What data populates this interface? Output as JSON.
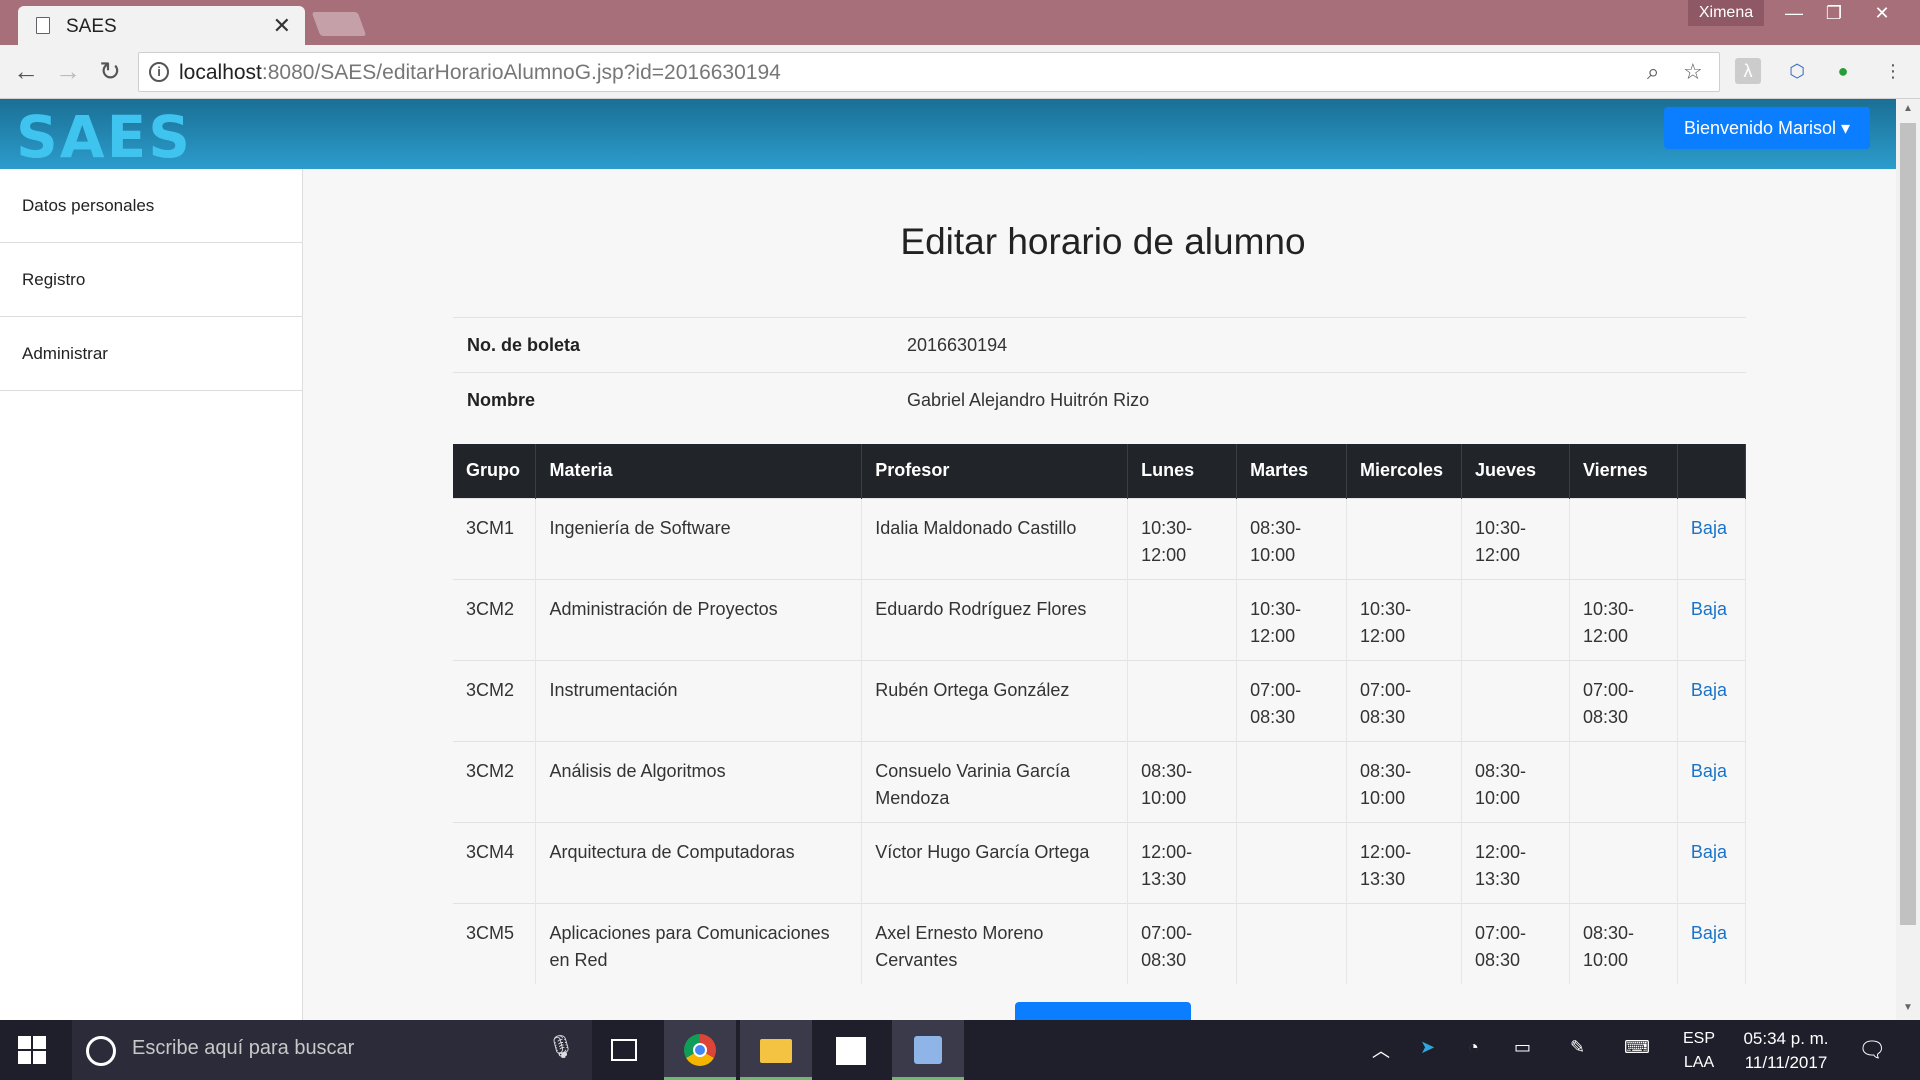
{
  "browser": {
    "tab_title": "SAES",
    "user": "Ximena",
    "url_host": "localhost",
    "url_rest": ":8080/SAES/editarHorarioAlumnoG.jsp?id=2016630194"
  },
  "app": {
    "logo": "SAES",
    "welcome": "Bienvenido Marisol ▾"
  },
  "sidebar": {
    "items": [
      {
        "label": "Datos personales"
      },
      {
        "label": "Registro"
      },
      {
        "label": "Administrar"
      }
    ]
  },
  "main": {
    "title": "Editar horario de alumno",
    "info": [
      {
        "label": "No. de boleta",
        "value": "2016630194"
      },
      {
        "label": "Nombre",
        "value": "Gabriel Alejandro Huitrón Rizo"
      }
    ],
    "columns": [
      "Grupo",
      "Materia",
      "Profesor",
      "Lunes",
      "Martes",
      "Miercoles",
      "Jueves",
      "Viernes",
      ""
    ],
    "rows": [
      {
        "grupo": "3CM1",
        "materia": "Ingeniería de Software",
        "profesor": "Idalia Maldonado Castillo",
        "lunes": "10:30-\n12:00",
        "martes": "08:30-\n10:00",
        "miercoles": "",
        "jueves": "10:30-\n12:00",
        "viernes": "",
        "accion": "Baja"
      },
      {
        "grupo": "3CM2",
        "materia": "Administración de Proyectos",
        "profesor": "Eduardo Rodríguez Flores",
        "lunes": "",
        "martes": "10:30-\n12:00",
        "miercoles": "10:30-\n12:00",
        "jueves": "",
        "viernes": "10:30-\n12:00",
        "accion": "Baja"
      },
      {
        "grupo": "3CM2",
        "materia": "Instrumentación",
        "profesor": "Rubén Ortega González",
        "lunes": "",
        "martes": "07:00-\n08:30",
        "miercoles": "07:00-\n08:30",
        "jueves": "",
        "viernes": "07:00-\n08:30",
        "accion": "Baja"
      },
      {
        "grupo": "3CM2",
        "materia": "Análisis de Algoritmos",
        "profesor": "Consuelo Varinia García Mendoza",
        "lunes": "08:30-\n10:00",
        "martes": "",
        "miercoles": "08:30-\n10:00",
        "jueves": "08:30-\n10:00",
        "viernes": "",
        "accion": "Baja"
      },
      {
        "grupo": "3CM4",
        "materia": "Arquitectura de Computadoras",
        "profesor": "Víctor Hugo García Ortega",
        "lunes": "12:00-\n13:30",
        "martes": "",
        "miercoles": "12:00-\n13:30",
        "jueves": "12:00-\n13:30",
        "viernes": "",
        "accion": "Baja"
      },
      {
        "grupo": "3CM5",
        "materia": "Aplicaciones para Comunicaciones en Red",
        "profesor": "Axel Ernesto Moreno Cervantes",
        "lunes": "07:00-\n08:30",
        "martes": "",
        "miercoles": "",
        "jueves": "07:00-\n08:30",
        "viernes": "08:30-\n10:00",
        "accion": "Baja"
      }
    ]
  },
  "taskbar": {
    "search_placeholder": "Escribe aquí para buscar",
    "lang_top": "ESP",
    "lang_bottom": "LAA",
    "time": "05:34 p. m.",
    "date": "11/11/2017"
  },
  "colors": {
    "titlebar": "#a66f79",
    "navbar": "#2c9ccc",
    "primary": "#0b7dff",
    "table_header": "#212529",
    "link": "#1a73c8"
  }
}
